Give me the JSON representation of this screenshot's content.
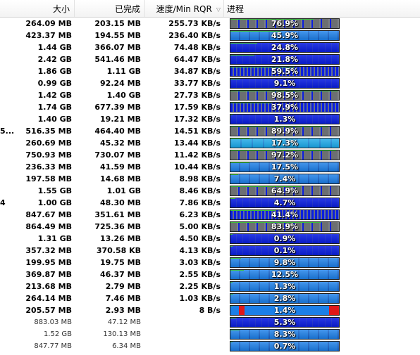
{
  "header": {
    "size_label": "大小",
    "done_label": "已完成",
    "speed_label": "速度/Min RQR",
    "progress_label": "进程"
  },
  "rows": [
    {
      "name": "",
      "size": "264.09 MB",
      "done": "203.15 MB",
      "speed": "255.73 KB/s",
      "progress": "76.9%",
      "progress_value": 0.769,
      "style": "gray"
    },
    {
      "name": "",
      "size": "423.37 MB",
      "done": "194.55 MB",
      "speed": "236.40 KB/s",
      "progress": "45.9%",
      "progress_value": 0.459,
      "style": "lightblue"
    },
    {
      "name": "",
      "size": "1.44 GB",
      "done": "366.07 MB",
      "speed": "74.48 KB/s",
      "progress": "24.8%",
      "progress_value": 0.248,
      "style": "blue"
    },
    {
      "name": "",
      "size": "2.42 GB",
      "done": "541.46 MB",
      "speed": "64.47 KB/s",
      "progress": "21.8%",
      "progress_value": 0.218,
      "style": "blue"
    },
    {
      "name": "",
      "size": "1.86 GB",
      "done": "1.11 GB",
      "speed": "34.87 KB/s",
      "progress": "59.5%",
      "progress_value": 0.595,
      "style": "stripe"
    },
    {
      "name": "",
      "size": "0.99 GB",
      "done": "92.24 MB",
      "speed": "33.77 KB/s",
      "progress": "9.1%",
      "progress_value": 0.091,
      "style": "blue"
    },
    {
      "name": "",
      "size": "1.42 GB",
      "done": "1.40 GB",
      "speed": "27.73 KB/s",
      "progress": "98.5%",
      "progress_value": 0.985,
      "style": "gray"
    },
    {
      "name": "",
      "size": "1.74 GB",
      "done": "677.39 MB",
      "speed": "17.59 KB/s",
      "progress": "37.9%",
      "progress_value": 0.379,
      "style": "stripe"
    },
    {
      "name": "",
      "size": "1.40 GB",
      "done": "19.21 MB",
      "speed": "17.32 KB/s",
      "progress": "1.3%",
      "progress_value": 0.013,
      "style": "blue"
    },
    {
      "name": "5....",
      "size": "516.35 MB",
      "done": "464.40 MB",
      "speed": "14.51 KB/s",
      "progress": "89.9%",
      "progress_value": 0.899,
      "style": "gray"
    },
    {
      "name": "",
      "size": "260.69 MB",
      "done": "45.32 MB",
      "speed": "13.44 KB/s",
      "progress": "17.3%",
      "progress_value": 0.173,
      "style": "cyan"
    },
    {
      "name": "",
      "size": "750.93 MB",
      "done": "730.07 MB",
      "speed": "11.42 KB/s",
      "progress": "97.2%",
      "progress_value": 0.972,
      "style": "gray"
    },
    {
      "name": "",
      "size": "236.33 MB",
      "done": "41.59 MB",
      "speed": "10.44 KB/s",
      "progress": "17.5%",
      "progress_value": 0.175,
      "style": "lightblue"
    },
    {
      "name": "",
      "size": "197.58 MB",
      "done": "14.68 MB",
      "speed": "8.98 KB/s",
      "progress": "7.4%",
      "progress_value": 0.074,
      "style": "lightblue"
    },
    {
      "name": "",
      "size": "1.55 GB",
      "done": "1.01 GB",
      "speed": "8.46 KB/s",
      "progress": "64.9%",
      "progress_value": 0.649,
      "style": "gray"
    },
    {
      "name": "4",
      "size": "1.00 GB",
      "done": "48.30 MB",
      "speed": "7.86 KB/s",
      "progress": "4.7%",
      "progress_value": 0.047,
      "style": "blue"
    },
    {
      "name": "",
      "size": "847.67 MB",
      "done": "351.61 MB",
      "speed": "6.23 KB/s",
      "progress": "41.4%",
      "progress_value": 0.414,
      "style": "stripe"
    },
    {
      "name": "",
      "size": "864.49 MB",
      "done": "725.36 MB",
      "speed": "5.00 KB/s",
      "progress": "83.9%",
      "progress_value": 0.839,
      "style": "gray"
    },
    {
      "name": "",
      "size": "1.31 GB",
      "done": "13.26 MB",
      "speed": "4.50 KB/s",
      "progress": "0.9%",
      "progress_value": 0.009,
      "style": "blue"
    },
    {
      "name": "",
      "size": "357.32 MB",
      "done": "370.58 KB",
      "speed": "4.13 KB/s",
      "progress": "0.1%",
      "progress_value": 0.001,
      "style": "blue"
    },
    {
      "name": "",
      "size": "199.95 MB",
      "done": "19.75 MB",
      "speed": "3.03 KB/s",
      "progress": "9.8%",
      "progress_value": 0.098,
      "style": "lightblue"
    },
    {
      "name": "",
      "size": "369.87 MB",
      "done": "46.37 MB",
      "speed": "2.55 KB/s",
      "progress": "12.5%",
      "progress_value": 0.125,
      "style": "lightblue"
    },
    {
      "name": "",
      "size": "213.68 MB",
      "done": "2.79 MB",
      "speed": "2.25 KB/s",
      "progress": "1.3%",
      "progress_value": 0.013,
      "style": "lightblue"
    },
    {
      "name": "",
      "size": "264.14 MB",
      "done": "7.46 MB",
      "speed": "1.03 KB/s",
      "progress": "2.8%",
      "progress_value": 0.028,
      "style": "lightblue"
    },
    {
      "name": "",
      "size": "205.57 MB",
      "done": "2.93 MB",
      "speed": "8 B/s",
      "progress": "1.4%",
      "progress_value": 0.014,
      "style": "red"
    },
    {
      "name": "",
      "size": "883.03 MB",
      "done": "47.12 MB",
      "speed": "",
      "progress": "5.3%",
      "progress_value": 0.053,
      "style": "blue",
      "inactive": true
    },
    {
      "name": "",
      "size": "1.52 GB",
      "done": "130.13 MB",
      "speed": "",
      "progress": "8.3%",
      "progress_value": 0.083,
      "style": "lightblue",
      "inactive": true
    },
    {
      "name": "",
      "size": "847.77 MB",
      "done": "6.34 MB",
      "speed": "",
      "progress": "0.7%",
      "progress_value": 0.007,
      "style": "lightblue",
      "inactive": true
    }
  ],
  "colors": {
    "gray": "#6c6f72",
    "blue": "#0a1ee0",
    "lightblue": "#1c7fe8",
    "cyan": "#1aa7e8",
    "red_segment": "#e01818",
    "grid_line": "#e2e2e2"
  }
}
